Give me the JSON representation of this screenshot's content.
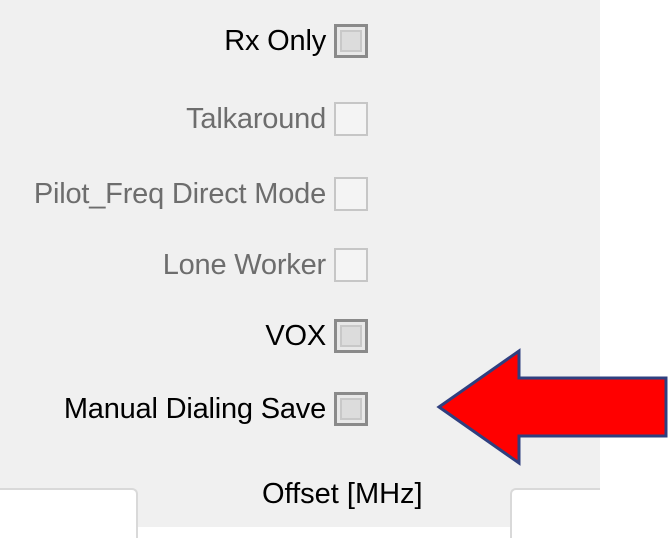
{
  "options": [
    {
      "label": "Rx Only",
      "enabled": true,
      "checked": false
    },
    {
      "label": "Talkaround",
      "enabled": false,
      "checked": false
    },
    {
      "label": "Pilot_Freq Direct Mode",
      "enabled": false,
      "checked": false
    },
    {
      "label": "Lone Worker",
      "enabled": false,
      "checked": false
    },
    {
      "label": "VOX",
      "enabled": true,
      "checked": false
    },
    {
      "label": "Manual Dialing Save",
      "enabled": true,
      "checked": false
    }
  ],
  "offset_label": "Offset [MHz]",
  "annotation": {
    "arrow_color": "#ff0000",
    "arrow_outline": "#2f3f7f",
    "points_to": "Manual Dialing Save"
  },
  "colors": {
    "panel_bg": "#f0f0f0",
    "disabled_text": "#6d6d6d"
  }
}
